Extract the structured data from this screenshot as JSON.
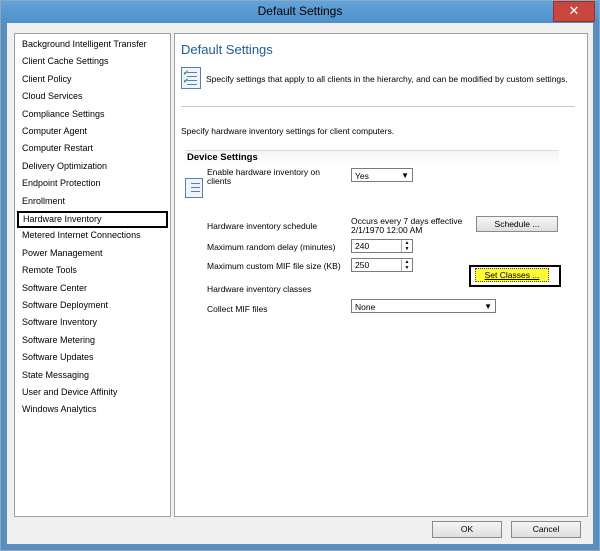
{
  "window": {
    "title": "Default Settings",
    "close_glyph": "✕"
  },
  "sidebar": {
    "items": [
      {
        "label": "Background Intelligent Transfer"
      },
      {
        "label": "Client Cache Settings"
      },
      {
        "label": "Client Policy"
      },
      {
        "label": "Cloud Services"
      },
      {
        "label": "Compliance Settings"
      },
      {
        "label": "Computer Agent"
      },
      {
        "label": "Computer Restart"
      },
      {
        "label": "Delivery Optimization"
      },
      {
        "label": "Endpoint Protection"
      },
      {
        "label": "Enrollment"
      },
      {
        "label": "Hardware Inventory",
        "selected": true
      },
      {
        "label": "Metered Internet Connections"
      },
      {
        "label": "Power Management"
      },
      {
        "label": "Remote Tools"
      },
      {
        "label": "Software Center"
      },
      {
        "label": "Software Deployment"
      },
      {
        "label": "Software Inventory"
      },
      {
        "label": "Software Metering"
      },
      {
        "label": "Software Updates"
      },
      {
        "label": "State Messaging"
      },
      {
        "label": "User and Device Affinity"
      },
      {
        "label": "Windows Analytics"
      }
    ]
  },
  "content": {
    "title": "Default Settings",
    "intro": "Specify settings that apply to all clients in the hierarchy, and can be modified by custom settings.",
    "hw_description": "Specify hardware inventory settings for client computers.",
    "group_header": "Device Settings",
    "fields": {
      "enable_label": "Enable hardware inventory on clients",
      "enable_value": "Yes",
      "schedule_label": "Hardware inventory schedule",
      "schedule_line1": "Occurs every 7 days effective",
      "schedule_line2": "2/1/1970 12:00 AM",
      "schedule_button": "Schedule ...",
      "delay_label": "Maximum random delay (minutes)",
      "delay_value": "240",
      "mif_size_label": "Maximum custom MIF file size (KB)",
      "mif_size_value": "250",
      "classes_label": "Hardware inventory classes",
      "classes_button": "Set Classes ...",
      "collect_mif_label": "Collect MIF files",
      "collect_mif_value": "None"
    }
  },
  "footer": {
    "ok_label": "OK",
    "cancel_label": "Cancel"
  },
  "colors": {
    "accent": "#1e5a99",
    "highlight": "#fffb33",
    "titlebar": "#5a9bd3"
  }
}
